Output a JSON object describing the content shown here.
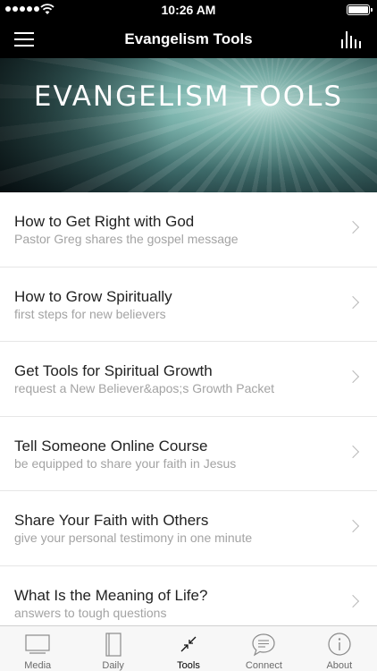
{
  "status_bar": {
    "time": "10:26 AM"
  },
  "nav": {
    "title": "Evangelism Tools",
    "menu_icon": "hamburger-icon",
    "audio_icon": "audio-bars-icon"
  },
  "hero": {
    "title": "EVANGELISM TOOLS"
  },
  "list": [
    {
      "title": "How to Get Right with God",
      "subtitle": "Pastor Greg shares the gospel message"
    },
    {
      "title": "How to Grow Spiritually",
      "subtitle": "first steps for new believers"
    },
    {
      "title": "Get Tools for Spiritual Growth",
      "subtitle": "request a New Believer&apos;s Growth Packet"
    },
    {
      "title": "Tell Someone Online Course",
      "subtitle": "be equipped to share your faith in Jesus"
    },
    {
      "title": "Share Your Faith with Others",
      "subtitle": "give your personal testimony in one minute"
    },
    {
      "title": "What Is the Meaning of Life?",
      "subtitle": "answers to tough questions"
    }
  ],
  "tabs": [
    {
      "label": "Media",
      "icon": "monitor-icon"
    },
    {
      "label": "Daily",
      "icon": "book-icon"
    },
    {
      "label": "Tools",
      "icon": "compress-arrows-icon",
      "active": true
    },
    {
      "label": "Connect",
      "icon": "chat-bubble-icon"
    },
    {
      "label": "About",
      "icon": "info-icon"
    }
  ]
}
